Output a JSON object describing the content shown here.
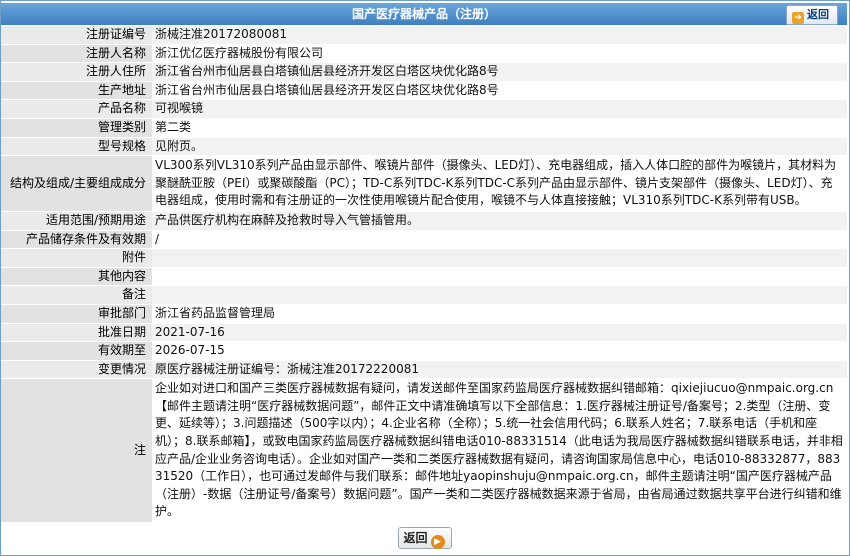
{
  "header": {
    "title": "国产医疗器械产品（注册）",
    "back_label": "返回"
  },
  "rows": [
    {
      "label": "注册证编号",
      "value": "浙械注准20172080081"
    },
    {
      "label": "注册人名称",
      "value": "浙江优亿医疗器械股份有限公司"
    },
    {
      "label": "注册人住所",
      "value": "浙江省台州市仙居县白塔镇仙居县经济开发区白塔区块优化路8号"
    },
    {
      "label": "生产地址",
      "value": "浙江省台州市仙居县白塔镇仙居县经济开发区白塔区块优化路8号"
    },
    {
      "label": "产品名称",
      "value": "可视喉镜"
    },
    {
      "label": "管理类别",
      "value": "第二类"
    },
    {
      "label": "型号规格",
      "value": "见附页。"
    },
    {
      "label": "结构及组成/主要组成成分",
      "value": "VL300系列VL310系列产品由显示部件、喉镜片部件（摄像头、LED灯）、充电器组成，插入人体口腔的部件为喉镜片，其材料为聚醚酰亚胺（PEI）或聚碳酸酯（PC）；TD-C系列TDC-K系列TDC-C系列产品由显示部件、镜片支架部件（摄像头、LED灯）、充电器组成，使用时需和有注册证的一次性使用喉镜片配合使用，喉镜不与人体直接接触；VL310系列TDC-K系列带有USB。"
    },
    {
      "label": "适用范围/预期用途",
      "value": "产品供医疗机构在麻醉及抢救时导入气管插管用。"
    },
    {
      "label": "产品储存条件及有效期",
      "value": "/"
    },
    {
      "label": "附件",
      "value": ""
    },
    {
      "label": "其他内容",
      "value": ""
    },
    {
      "label": "备注",
      "value": ""
    },
    {
      "label": "审批部门",
      "value": "浙江省药品监督管理局"
    },
    {
      "label": "批准日期",
      "value": "2021-07-16"
    },
    {
      "label": "有效期至",
      "value": "2026-07-15"
    },
    {
      "label": "变更情况",
      "value": "原医疗器械注册证编号：浙械注准20172220081"
    },
    {
      "label": "注",
      "value": "企业如对进口和国产三类医疗器械数据有疑问，请发送邮件至国家药监局医疗器械数据纠错邮箱：qixiejiucuo@nmpaic.org.cn【邮件主题请注明“医疗器械数据问题”，邮件正文中请准确填写以下全部信息：1.医疗器械注册证号/备案号；2.类型（注册、变更、延续等）；3.问题描述（500字以内）；4.企业名称（全称）；5.统一社会信用代码；6.联系人姓名；7.联系电话（手机和座机）；8.联系邮箱】，或致电国家药监局医疗器械数据纠错电话010-88331514（此电话为我局医疗器械数据纠错联系电话，并非相应产品/企业业务咨询电话）。企业如对国产一类和二类医疗器械数据有疑问，请咨询国家局信息中心，电话010-88332877，88331520（工作日），也可通过发邮件与我们联系：邮件地址yaopinshuju@nmpaic.org.cn，邮件主题请注明“国产医疗器械产品（注册）-数据（注册证号/备案号）数据问题”。国产一类和二类医疗器械数据来源于省局，由省局通过数据共享平台进行纠错和维护。"
    }
  ],
  "footer": {
    "back_label": "返回"
  }
}
